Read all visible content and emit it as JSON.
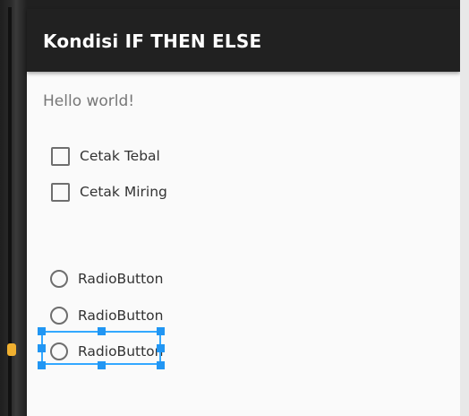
{
  "app": {
    "title": "Kondisi IF THEN ELSE"
  },
  "content": {
    "hello_text": "Hello world!"
  },
  "checkboxes": [
    {
      "label": "Cetak Tebal",
      "checked": false
    },
    {
      "label": "Cetak Miring",
      "checked": false
    }
  ],
  "radios": [
    {
      "label": "RadioButton",
      "selected": false
    },
    {
      "label": "RadioButton",
      "selected": false
    },
    {
      "label": "RadioButton",
      "selected": false
    }
  ],
  "colors": {
    "appbar": "#212121",
    "selection": "#2196f3",
    "background": "#fafafa"
  }
}
